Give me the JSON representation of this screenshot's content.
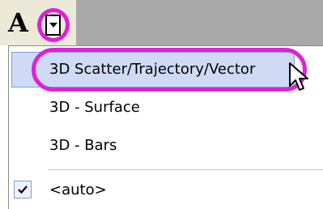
{
  "toolbar": {
    "font_button_label": "A",
    "dropdown_icon": "chevron-down-icon"
  },
  "menu": {
    "items": [
      {
        "label": "3D Scatter/Trajectory/Vector",
        "highlighted": true
      },
      {
        "label": "3D - Surface"
      },
      {
        "label": "3D - Bars"
      },
      {
        "label": "<auto>",
        "checked": true,
        "icon": "checkmark-icon"
      }
    ]
  },
  "colors": {
    "annotation_ring": "#e020d8",
    "highlight_fill": "#cfdaf5",
    "toolbar_gray": "#a9a9a9"
  }
}
